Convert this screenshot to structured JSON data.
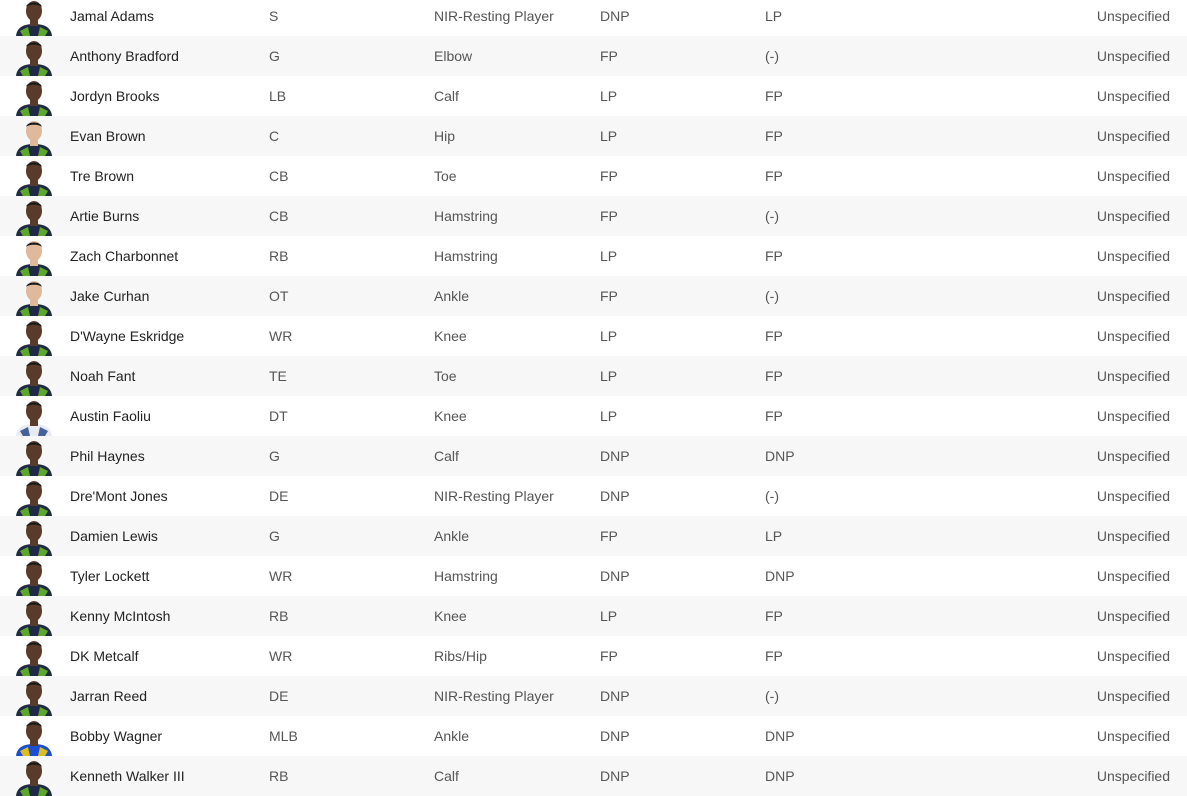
{
  "colors": {
    "row_alt_bg": "#f7f7f7",
    "skin_dark": "#5a3a28",
    "skin_light": "#e0b89a",
    "seahawks_navy": "#1f2a44",
    "seahawks_green": "#69be28",
    "cowboys_white": "#e8ecf2",
    "cowboys_blue": "#2a4a8a",
    "rams_blue": "#1a4fd0"
  },
  "rows": [
    {
      "name": "Jamal Adams",
      "position": "S",
      "injury": "NIR-Resting Player",
      "wed": "DNP",
      "thu": "LP",
      "status": "Unspecified",
      "avatar_icon": "player-headshot-icon"
    },
    {
      "name": "Anthony Bradford",
      "position": "G",
      "injury": "Elbow",
      "wed": "FP",
      "thu": "(-)",
      "status": "Unspecified",
      "avatar_icon": "player-headshot-icon"
    },
    {
      "name": "Jordyn Brooks",
      "position": "LB",
      "injury": "Calf",
      "wed": "LP",
      "thu": "FP",
      "status": "Unspecified",
      "avatar_icon": "player-headshot-icon"
    },
    {
      "name": "Evan Brown",
      "position": "C",
      "injury": "Hip",
      "wed": "LP",
      "thu": "FP",
      "status": "Unspecified",
      "avatar_icon": "player-headshot-icon"
    },
    {
      "name": "Tre Brown",
      "position": "CB",
      "injury": "Toe",
      "wed": "FP",
      "thu": "FP",
      "status": "Unspecified",
      "avatar_icon": "player-headshot-icon"
    },
    {
      "name": "Artie Burns",
      "position": "CB",
      "injury": "Hamstring",
      "wed": "FP",
      "thu": "(-)",
      "status": "Unspecified",
      "avatar_icon": "player-headshot-icon"
    },
    {
      "name": "Zach Charbonnet",
      "position": "RB",
      "injury": "Hamstring",
      "wed": "LP",
      "thu": "FP",
      "status": "Unspecified",
      "avatar_icon": "player-headshot-icon"
    },
    {
      "name": "Jake Curhan",
      "position": "OT",
      "injury": "Ankle",
      "wed": "FP",
      "thu": "(-)",
      "status": "Unspecified",
      "avatar_icon": "player-headshot-icon"
    },
    {
      "name": "D'Wayne Eskridge",
      "position": "WR",
      "injury": "Knee",
      "wed": "LP",
      "thu": "FP",
      "status": "Unspecified",
      "avatar_icon": "player-headshot-icon"
    },
    {
      "name": "Noah Fant",
      "position": "TE",
      "injury": "Toe",
      "wed": "LP",
      "thu": "FP",
      "status": "Unspecified",
      "avatar_icon": "player-headshot-icon"
    },
    {
      "name": "Austin Faoliu",
      "position": "DT",
      "injury": "Knee",
      "wed": "LP",
      "thu": "FP",
      "status": "Unspecified",
      "avatar_icon": "player-headshot-icon"
    },
    {
      "name": "Phil Haynes",
      "position": "G",
      "injury": "Calf",
      "wed": "DNP",
      "thu": "DNP",
      "status": "Unspecified",
      "avatar_icon": "player-headshot-icon"
    },
    {
      "name": "Dre'Mont Jones",
      "position": "DE",
      "injury": "NIR-Resting Player",
      "wed": "DNP",
      "thu": "(-)",
      "status": "Unspecified",
      "avatar_icon": "player-headshot-icon"
    },
    {
      "name": "Damien Lewis",
      "position": "G",
      "injury": "Ankle",
      "wed": "FP",
      "thu": "LP",
      "status": "Unspecified",
      "avatar_icon": "player-headshot-icon"
    },
    {
      "name": "Tyler Lockett",
      "position": "WR",
      "injury": "Hamstring",
      "wed": "DNP",
      "thu": "DNP",
      "status": "Unspecified",
      "avatar_icon": "player-headshot-icon"
    },
    {
      "name": "Kenny McIntosh",
      "position": "RB",
      "injury": "Knee",
      "wed": "LP",
      "thu": "FP",
      "status": "Unspecified",
      "avatar_icon": "player-headshot-icon"
    },
    {
      "name": "DK Metcalf",
      "position": "WR",
      "injury": "Ribs/Hip",
      "wed": "FP",
      "thu": "FP",
      "status": "Unspecified",
      "avatar_icon": "player-headshot-icon"
    },
    {
      "name": "Jarran Reed",
      "position": "DE",
      "injury": "NIR-Resting Player",
      "wed": "DNP",
      "thu": "(-)",
      "status": "Unspecified",
      "avatar_icon": "player-headshot-icon"
    },
    {
      "name": "Bobby Wagner",
      "position": "MLB",
      "injury": "Ankle",
      "wed": "DNP",
      "thu": "DNP",
      "status": "Unspecified",
      "avatar_icon": "player-headshot-icon"
    },
    {
      "name": "Kenneth Walker III",
      "position": "RB",
      "injury": "Calf",
      "wed": "DNP",
      "thu": "DNP",
      "status": "Unspecified",
      "avatar_icon": "player-headshot-icon"
    }
  ]
}
